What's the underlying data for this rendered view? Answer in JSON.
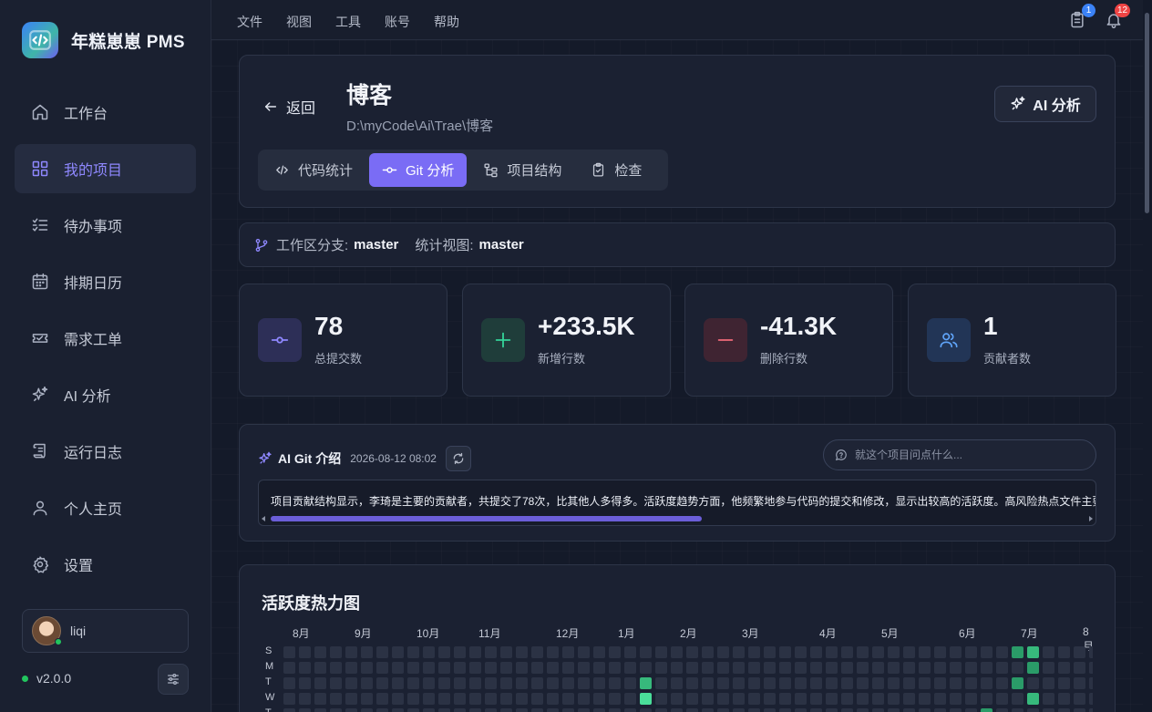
{
  "app": {
    "name": "年糕崽崽 PMS",
    "logo_icon": "code-brackets-icon"
  },
  "sidebar": {
    "items": [
      {
        "label": "工作台",
        "icon": "home-icon",
        "active": false
      },
      {
        "label": "我的项目",
        "icon": "grid-icon",
        "active": true
      },
      {
        "label": "待办事项",
        "icon": "checklist-icon",
        "active": false
      },
      {
        "label": "排期日历",
        "icon": "calendar-icon",
        "active": false
      },
      {
        "label": "需求工单",
        "icon": "ticket-icon",
        "active": false
      },
      {
        "label": "AI 分析",
        "icon": "sparkles-icon",
        "active": false
      },
      {
        "label": "运行日志",
        "icon": "scroll-icon",
        "active": false
      },
      {
        "label": "个人主页",
        "icon": "user-icon",
        "active": false
      },
      {
        "label": "设置",
        "icon": "gear-icon",
        "active": false
      }
    ],
    "user": {
      "name": "liqi",
      "status": "online"
    },
    "version": "v2.0.0"
  },
  "topbar": {
    "menu": [
      "文件",
      "视图",
      "工具",
      "账号",
      "帮助"
    ],
    "clipboard_badge": "1",
    "bell_badge": "12"
  },
  "header": {
    "back_label": "返回",
    "title": "博客",
    "path": "D:\\myCode\\Ai\\Trae\\博客",
    "ai_button": "AI 分析",
    "tabs": [
      {
        "label": "代码统计",
        "icon": "code-icon",
        "active": false
      },
      {
        "label": "Git 分析",
        "icon": "git-commit-icon",
        "active": true
      },
      {
        "label": "项目结构",
        "icon": "tree-icon",
        "active": false
      },
      {
        "label": "检查",
        "icon": "clipboard-check-icon",
        "active": false
      }
    ]
  },
  "branch": {
    "workspace_label": "工作区分支:",
    "workspace_value": "master",
    "view_label": "统计视图:",
    "view_value": "master"
  },
  "stats": [
    {
      "value": "78",
      "label": "总提交数",
      "icon": "git-commit-icon",
      "color": "#8f88ff",
      "bg": "#2d2f57"
    },
    {
      "value": "+233.5K",
      "label": "新增行数",
      "icon": "plus-icon",
      "color": "#34d399",
      "bg": "#1f3d3a"
    },
    {
      "value": "-41.3K",
      "label": "删除行数",
      "icon": "minus-icon",
      "color": "#f16a7a",
      "bg": "#3f2432"
    },
    {
      "value": "1",
      "label": "贡献者数",
      "icon": "users-icon",
      "color": "#60a5fa",
      "bg": "#223556"
    }
  ],
  "ai_intro": {
    "title": "AI Git 介绍",
    "timestamp": "2026-08-12 08:02",
    "ask_placeholder": "就这个项目问点什么...",
    "text": "项目贡献结构显示，李琦是主要的贡献者，共提交了78次，比其他人多得多。活跃度趋势方面，他频繁地参与代码的提交和修改，显示出较高的活跃度。高风险热点文件主要包括AI"
  },
  "heatmap": {
    "title": "活跃度热力图",
    "months": [
      "8月",
      "9月",
      "10月",
      "11月",
      "12月",
      "1月",
      "2月",
      "3月",
      "4月",
      "5月",
      "6月",
      "7月",
      "8月"
    ],
    "day_labels": [
      "S",
      "M",
      "T",
      "W",
      "T"
    ],
    "empty_color": "#2b3244",
    "active_cells": [
      {
        "week": 23,
        "day": 2,
        "level": 3
      },
      {
        "week": 23,
        "day": 3,
        "level": 4
      },
      {
        "week": 47,
        "day": 0,
        "level": 2
      },
      {
        "week": 47,
        "day": 2,
        "level": 2
      },
      {
        "week": 48,
        "day": 0,
        "level": 3
      },
      {
        "week": 48,
        "day": 1,
        "level": 2
      },
      {
        "week": 48,
        "day": 3,
        "level": 3
      },
      {
        "week": 45,
        "day": 4,
        "level": 2
      }
    ],
    "level_colors": [
      "#2b3244",
      "#1f6f50",
      "#2a9b68",
      "#37b97c",
      "#4ade9a"
    ]
  }
}
